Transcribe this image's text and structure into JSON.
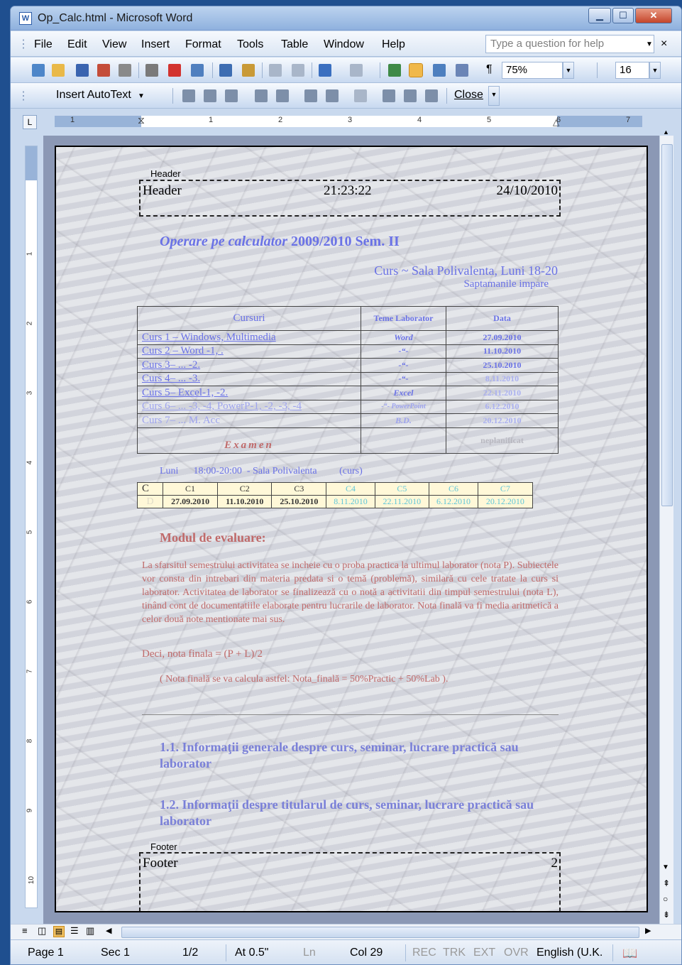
{
  "window": {
    "title": "Op_Calc.html - Microsoft Word",
    "app_icon_label": "W"
  },
  "menubar": {
    "items": [
      "File",
      "Edit",
      "View",
      "Insert",
      "Format",
      "Tools",
      "Table",
      "Window",
      "Help"
    ],
    "help_placeholder": "Type a question for help",
    "close_glyph": "×"
  },
  "toolbar": {
    "zoom": "75%",
    "font_size": "16",
    "pilcrow": "¶"
  },
  "header_footer_toolbar": {
    "insert_autotext": "Insert AutoText",
    "close": "Close"
  },
  "ruler": {
    "numbers": [
      "1",
      "1",
      "2",
      "3",
      "4",
      "5",
      "6",
      "7"
    ],
    "vertical_numbers": [
      "1",
      "2",
      "3",
      "4",
      "5",
      "6",
      "7",
      "8",
      "9",
      "10"
    ],
    "tab_selector": "L"
  },
  "document": {
    "header": {
      "label": "Header",
      "left": "Header",
      "center": "21:23:22",
      "right": "24/10/2010"
    },
    "title_italic": "Operare pe calculator",
    "title_rest": "2009/2010 Sem. II",
    "subtitle": "Curs ~ Sala Polivalenta, Luni 18-20",
    "subtitle2": "Saptamanile impare",
    "courses_table": {
      "headers": [
        "Cursuri",
        "Teme Laborator",
        "Data"
      ],
      "rows": [
        [
          "Curs 1 – Windows, Multimedia",
          "Word",
          "27.09.2010"
        ],
        [
          "Curs 2 – Word -1, .",
          "-“-",
          "11.10.2010"
        ],
        [
          "Curs 3– ...  -2.",
          "-“-",
          "25.10.2010"
        ],
        [
          "Curs 4– ...  -3.",
          "-“-",
          "8.11.2010"
        ],
        [
          "Curs 5– Excel-1, -2.",
          "Excel",
          "22.11.2010"
        ],
        [
          "Curs 6– ... -3, -4, PowerP-1, -2, -3, -4",
          "-“- PowerPoint",
          "6.12.2010"
        ],
        [
          "Curs 7– ... M. Acc",
          "B.D.",
          "20.12.2010"
        ]
      ],
      "exam": "Examen",
      "exam_date": "neplanificat"
    },
    "schedule_line": "Luni      18:00-20:00  - Sala Polivalenta         (curs)",
    "schedule_table": {
      "row1": [
        "C",
        "C1",
        "C2",
        "C3",
        "C4",
        "C5",
        "C6",
        "C7"
      ],
      "row2": [
        "D",
        "27.09.2010",
        "11.10.2010",
        "25.10.2010",
        "8.11.2010",
        "22.11.2010",
        "6.12.2010",
        "20.12.2010"
      ]
    },
    "evaluation_heading": "Modul de evaluare:",
    "evaluation_paragraph": "La sfarsitul semestrului activitatea se incheie cu o proba practica la ultimul laborator (nota P). Subiectele vor consta din intrebari din materia predata si o temă (problemă), similară cu cele tratate la curs si laborator. Activitatea de laborator se finalizează cu o notă a activitatii din timpul semestrului (nota L), tinând cont de documentatiile elaborate pentru lucrarile de laborator. Nota finală va fi media aritmetică a celor două note mentionate mai sus.",
    "final_grade_line": "Deci, nota finala = (P + L)/2",
    "final_grade_note": "( Nota finală se va calcula astfel: Nota_finală = 50%Practic + 50%Lab ).",
    "section_1_1": "1.1.      Informaţii generale despre curs, seminar, lucrare practică sau laborator",
    "section_1_2": "1.2.      Informaţii despre titularul de curs, seminar, lucrare practică sau laborator",
    "footer": {
      "label": "Footer",
      "left": "Footer",
      "right": "2"
    }
  },
  "statusbar": {
    "page": "Page 1",
    "sec": "Sec 1",
    "pages": "1/2",
    "at": "At 0.5\"",
    "ln": "Ln",
    "col": "Col 29",
    "rec": "REC",
    "trk": "TRK",
    "ext": "EXT",
    "ovr": "OVR",
    "language": "English (U.K."
  },
  "colors": {
    "heading_blue": "#6a72e6",
    "eval_red": "#c06a6a",
    "xp_titlebar": "#8fb1de"
  }
}
